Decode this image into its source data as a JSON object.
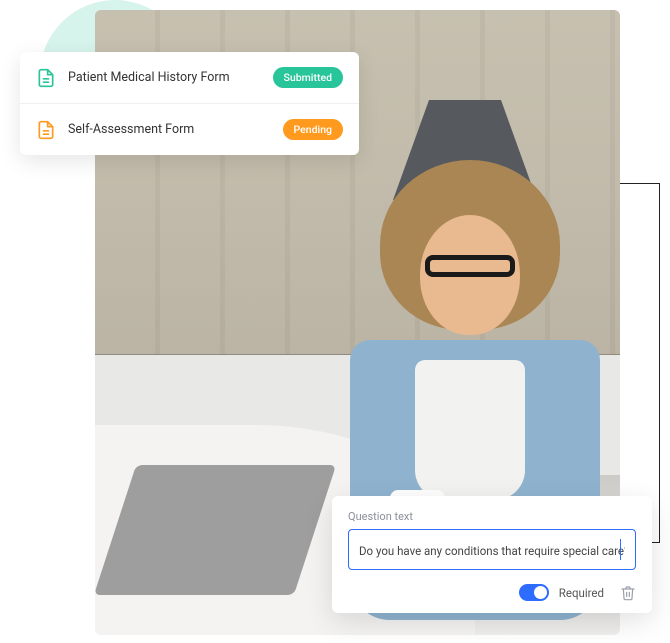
{
  "colors": {
    "accent_blue": "#2e6bff",
    "mint": "#d6f3ec",
    "badge_submitted": "#29c59a",
    "badge_pending": "#ff9a1f"
  },
  "forms": [
    {
      "icon": "document-icon",
      "icon_color": "#29c59a",
      "label": "Patient Medical History Form",
      "status": "Submitted",
      "status_class": "submitted"
    },
    {
      "icon": "document-icon",
      "icon_color": "#ff9a1f",
      "label": "Self-Assessment Form",
      "status": "Pending",
      "status_class": "pending"
    }
  ],
  "question": {
    "field_label": "Question text",
    "value": "Do you have any conditions that require special care?",
    "required_label": "Required",
    "required_on": true
  }
}
